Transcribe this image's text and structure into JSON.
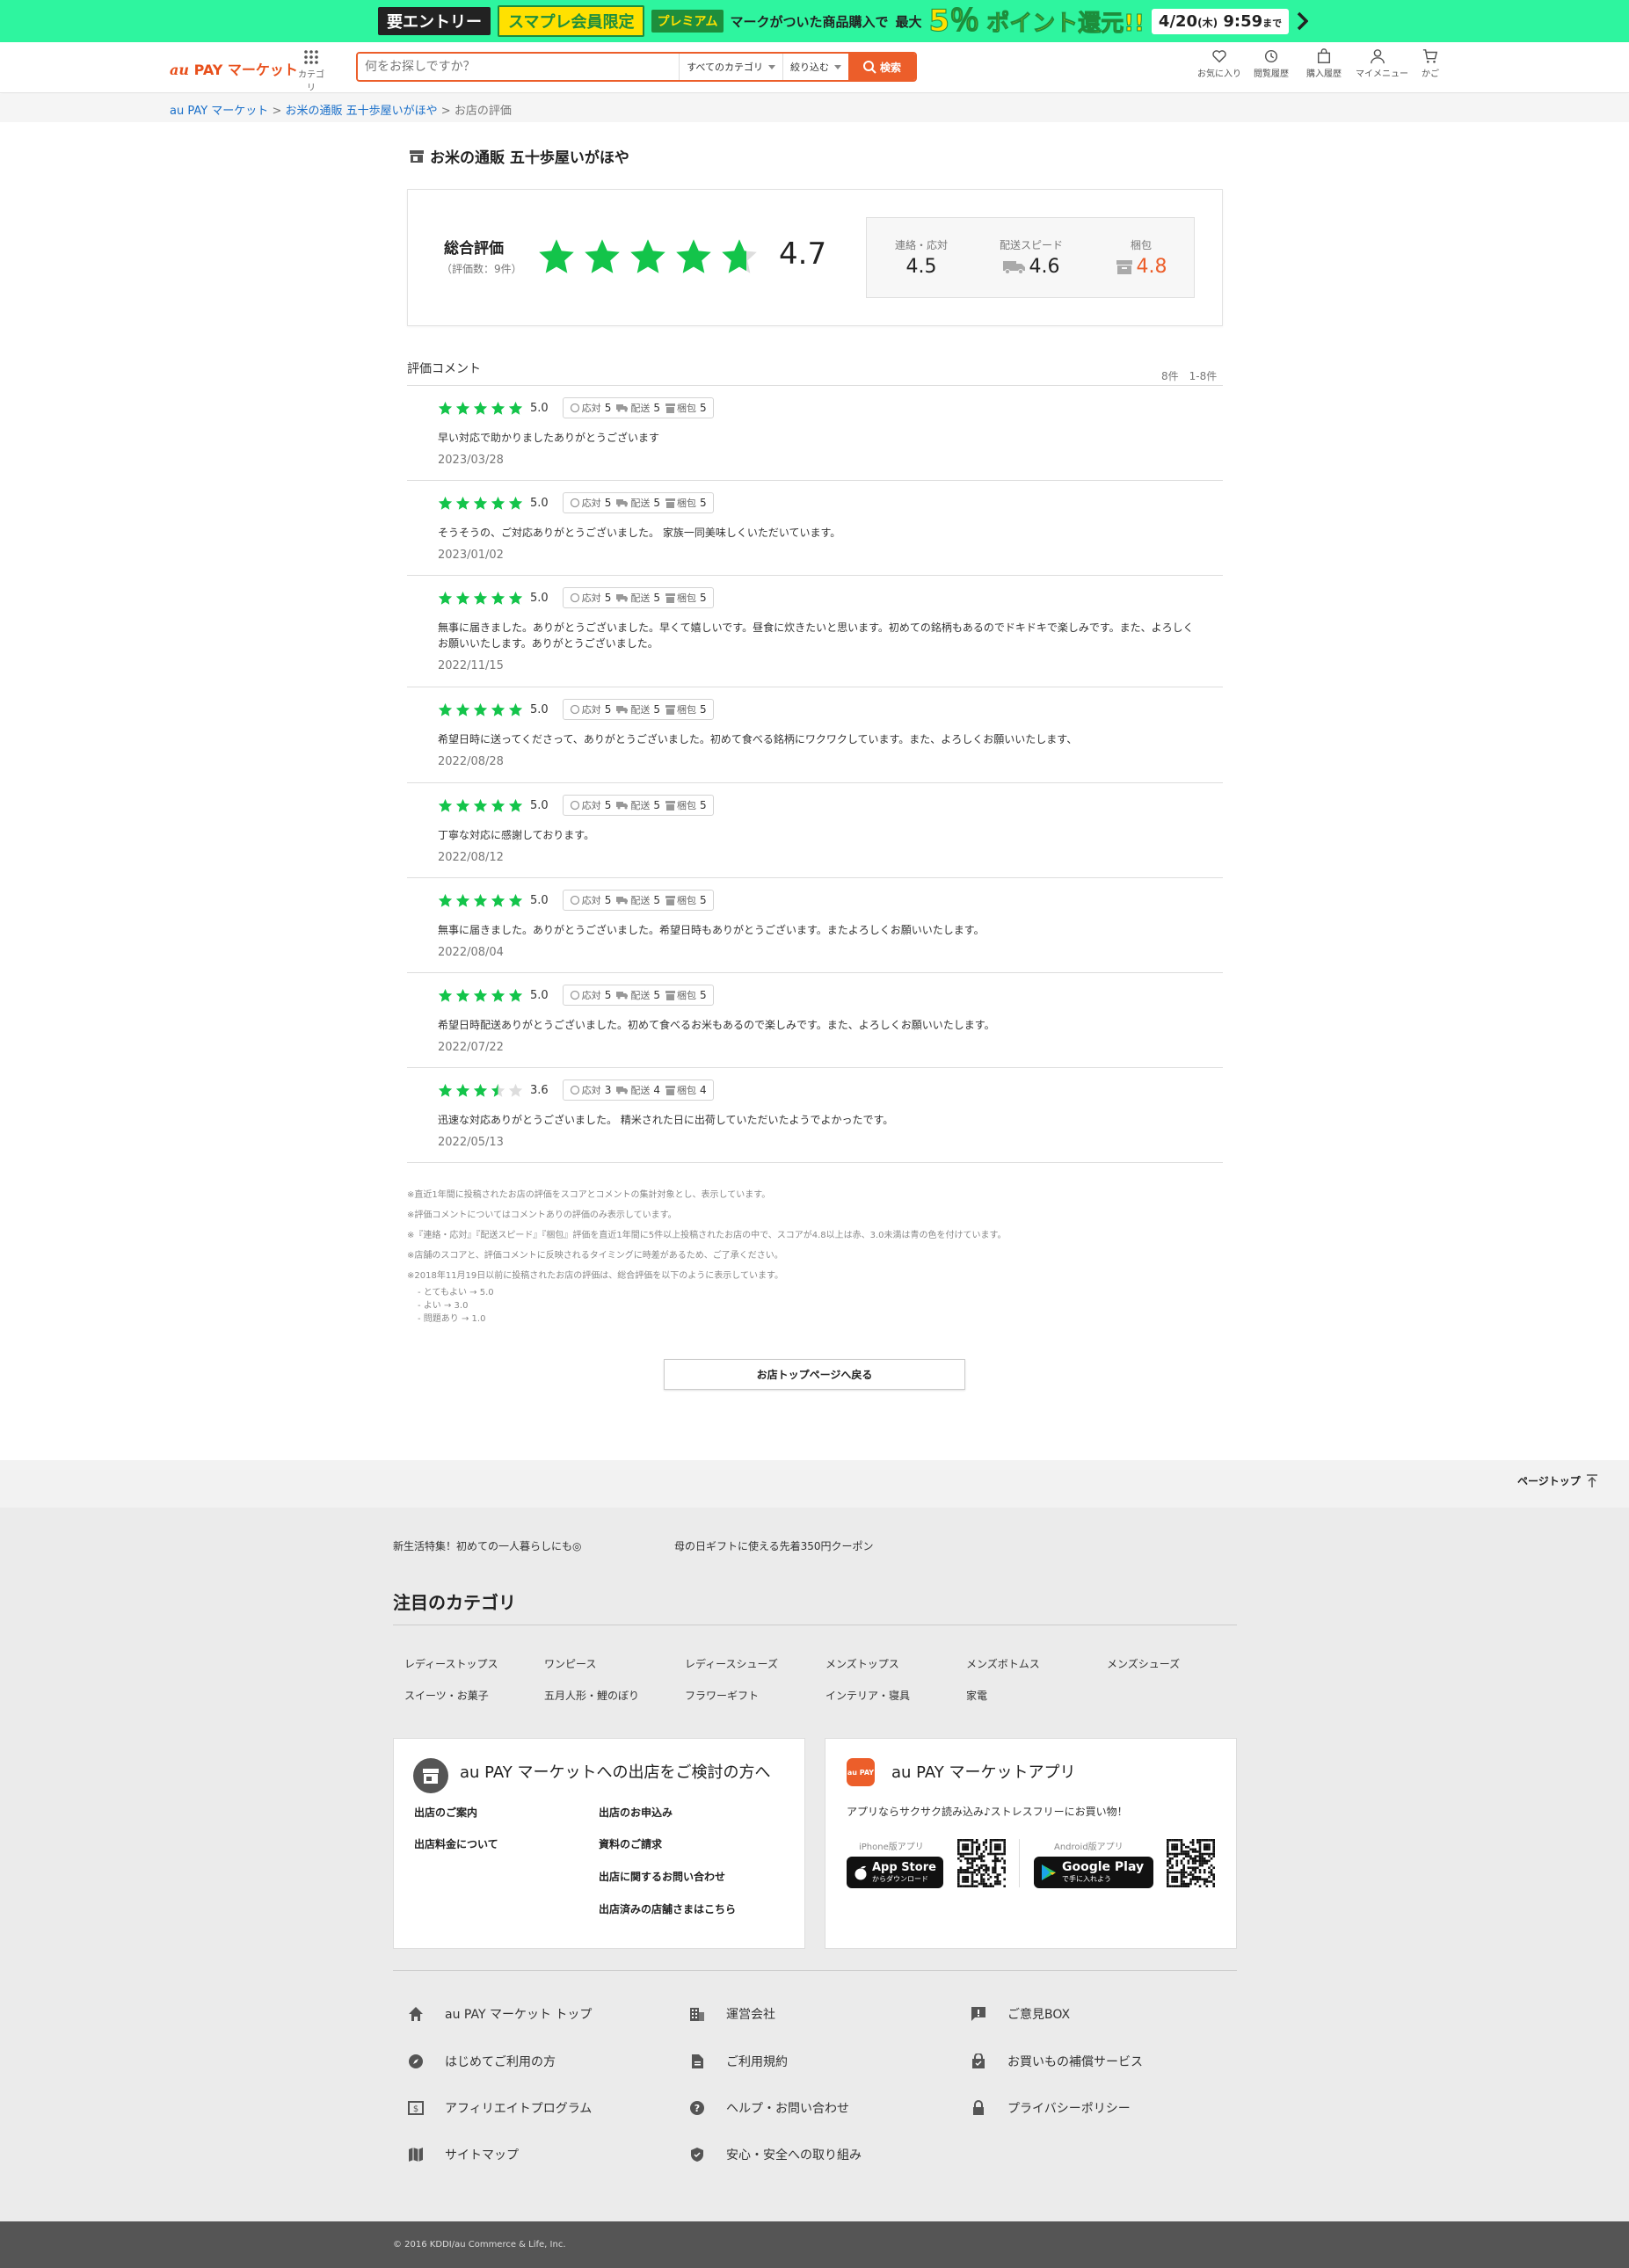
{
  "colors": {
    "accent": "#ec5e2a",
    "star": "#13c44a",
    "promo_bg": "#2ef59f"
  },
  "promo": {
    "tag_entry": "要エントリー",
    "tag_member": "スマプレ会員限定",
    "tag_premium": "プレミアム",
    "text": "マークがついた商品購入で",
    "max_label": "最大",
    "percent": "5％",
    "reward": "ポイント還元!!",
    "date": "4/20",
    "weekday": "(木)",
    "time": "9:59",
    "until": "まで"
  },
  "header": {
    "logo_au": "au",
    "logo_rest": "PAY マーケット",
    "category_label": "カテゴリ",
    "search_placeholder": "何をお探しですか？",
    "category_select": "すべてのカテゴリ",
    "filter_select": "絞り込む",
    "search_button": "検索",
    "icons": [
      {
        "icon": "heart-icon",
        "label": "お気に入り"
      },
      {
        "icon": "history-icon",
        "label": "閲覧履歴"
      },
      {
        "icon": "bag-icon",
        "label": "購入履歴"
      },
      {
        "icon": "person-icon",
        "label": "マイメニュー"
      },
      {
        "icon": "cart-icon",
        "label": "かご"
      }
    ]
  },
  "breadcrumb": {
    "home": "au PAY マーケット",
    "shop": "お米の通販 五十歩屋いがほや",
    "current": "お店の評価",
    "sep": ">"
  },
  "shop": {
    "name": "お米の通販 五十歩屋いがほや",
    "total_label": "総合評価",
    "total_count": "（評価数：9件）",
    "total_score": "4.7",
    "total_stars": 4.7,
    "sub": [
      {
        "label": "連絡・応対",
        "value": "4.5",
        "icon": ""
      },
      {
        "label": "配送スピード",
        "value": "4.6",
        "icon": "truck-icon"
      },
      {
        "label": "梱包",
        "value": "4.8",
        "icon": "box-icon"
      }
    ]
  },
  "reviews_section": {
    "heading": "評価コメント",
    "count": "8件　1-8件",
    "sub_labels": [
      "応対",
      "配送",
      "梱包"
    ]
  },
  "reviews": [
    {
      "score": "5.0",
      "stars": 5,
      "sub": [
        "5",
        "5",
        "5"
      ],
      "comment": "早い対応で助かりましたありがとうございます",
      "date": "2023/03/28"
    },
    {
      "score": "5.0",
      "stars": 5,
      "sub": [
        "5",
        "5",
        "5"
      ],
      "comment": "そうそうの、ご対応ありがとうございました。 家族一同美味しくいただいています。",
      "date": "2023/01/02"
    },
    {
      "score": "5.0",
      "stars": 5,
      "sub": [
        "5",
        "5",
        "5"
      ],
      "comment": "無事に届きました。ありがとうございました。早くて嬉しいです。昼食に炊きたいと思います。初めての銘柄もあるのでドキドキで楽しみです。また、よろしくお願いいたします。ありがとうございました。",
      "date": "2022/11/15"
    },
    {
      "score": "5.0",
      "stars": 5,
      "sub": [
        "5",
        "5",
        "5"
      ],
      "comment": "希望日時に送ってくださって、ありがとうございました。初めて食べる銘柄にワクワクしています。また、よろしくお願いいたします、",
      "date": "2022/08/28"
    },
    {
      "score": "5.0",
      "stars": 5,
      "sub": [
        "5",
        "5",
        "5"
      ],
      "comment": "丁寧な対応に感謝しております。",
      "date": "2022/08/12"
    },
    {
      "score": "5.0",
      "stars": 5,
      "sub": [
        "5",
        "5",
        "5"
      ],
      "comment": "無事に届きました。ありがとうございました。希望日時もありがとうございます。またよろしくお願いいたします。",
      "date": "2022/08/04"
    },
    {
      "score": "5.0",
      "stars": 5,
      "sub": [
        "5",
        "5",
        "5"
      ],
      "comment": "希望日時配送ありがとうございました。初めて食べるお米もあるので楽しみです。また、よろしくお願いいたします。",
      "date": "2022/07/22"
    },
    {
      "score": "3.6",
      "stars": 3.5,
      "sub": [
        "3",
        "4",
        "4"
      ],
      "comment": "迅速な対応ありがとうございました。 精米された日に出荷していただいたようでよかったです。",
      "date": "2022/05/13"
    }
  ],
  "notes": [
    "※直近1年間に投稿されたお店の評価をスコアとコメントの集計対象とし、表示しています。",
    "※評価コメントについてはコメントありの評価のみ表示しています。",
    "※『連絡・応対』『配送スピード』『梱包』評価を直近1年間に5件以上投稿されたお店の中で、スコアが4.8以上は赤、3.0未満は青の色を付けています。",
    "※店舗のスコアと、評価コメントに反映されるタイミングに時差があるため、ご了承ください。",
    "※2018年11月19日以前に投稿されたお店の評価は、総合評価を以下のように表示しています。"
  ],
  "notes_sub": [
    "- とてもよい → 5.0",
    "- よい → 3.0",
    "- 問題あり → 1.0"
  ],
  "back_button": "お店トップページへ戻る",
  "footer": {
    "page_top": "ページトップ",
    "links": [
      "新生活特集！初めての一人暮らしにも◎",
      "母の日ギフトに使える先着350円クーポン"
    ],
    "category_title": "注目のカテゴリ",
    "categories": [
      "レディーストップス",
      "ワンピース",
      "レディースシューズ",
      "メンズトップス",
      "メンズボトムス",
      "メンズシューズ",
      "スイーツ・お菓子",
      "五月人形・鯉のぼり",
      "フラワーギフト",
      "インテリア・寝具",
      "家電"
    ],
    "seller_card": {
      "title": "au PAY マーケットへの出店をご検討の方へ",
      "links": [
        "出店のご案内",
        "出店のお申込み",
        "出店料金について",
        "資料のご請求",
        "出店に関するお問い合わせ",
        "出店済みの店舗さまはこちら"
      ]
    },
    "app_card": {
      "title": "au PAY マーケットアプリ",
      "desc": "アプリならサクサク読み込み♪ストレスフリーにお買い物！",
      "iphone_label": "iPhone版アプリ",
      "android_label": "Android版アプリ",
      "appstore_top": "App Store",
      "appstore_sub": "からダウンロード",
      "gplay_top": "Google Play",
      "gplay_sub": "で手に入れよう",
      "app_icon_text": "au PAY"
    },
    "nav": [
      {
        "icon": "home-icon",
        "label": "au PAY マーケット トップ"
      },
      {
        "icon": "building-icon",
        "label": "運営会社"
      },
      {
        "icon": "feedback-icon",
        "label": "ご意見BOX"
      },
      {
        "icon": "compass-icon",
        "label": "はじめてご利用の方"
      },
      {
        "icon": "document-icon",
        "label": "ご利用規約"
      },
      {
        "icon": "shopping-lock-icon",
        "label": "お買いもの補償サービス"
      },
      {
        "icon": "affiliate-icon",
        "label": "アフィリエイトプログラム"
      },
      {
        "icon": "help-icon",
        "label": "ヘルプ・お問い合わせ"
      },
      {
        "icon": "lock-icon",
        "label": "プライバシーポリシー"
      },
      {
        "icon": "map-icon",
        "label": "サイトマップ"
      },
      {
        "icon": "shield-icon",
        "label": "安心・安全への取り組み"
      }
    ],
    "copyright": "© 2016 KDDI/au Commerce & Life, Inc."
  }
}
